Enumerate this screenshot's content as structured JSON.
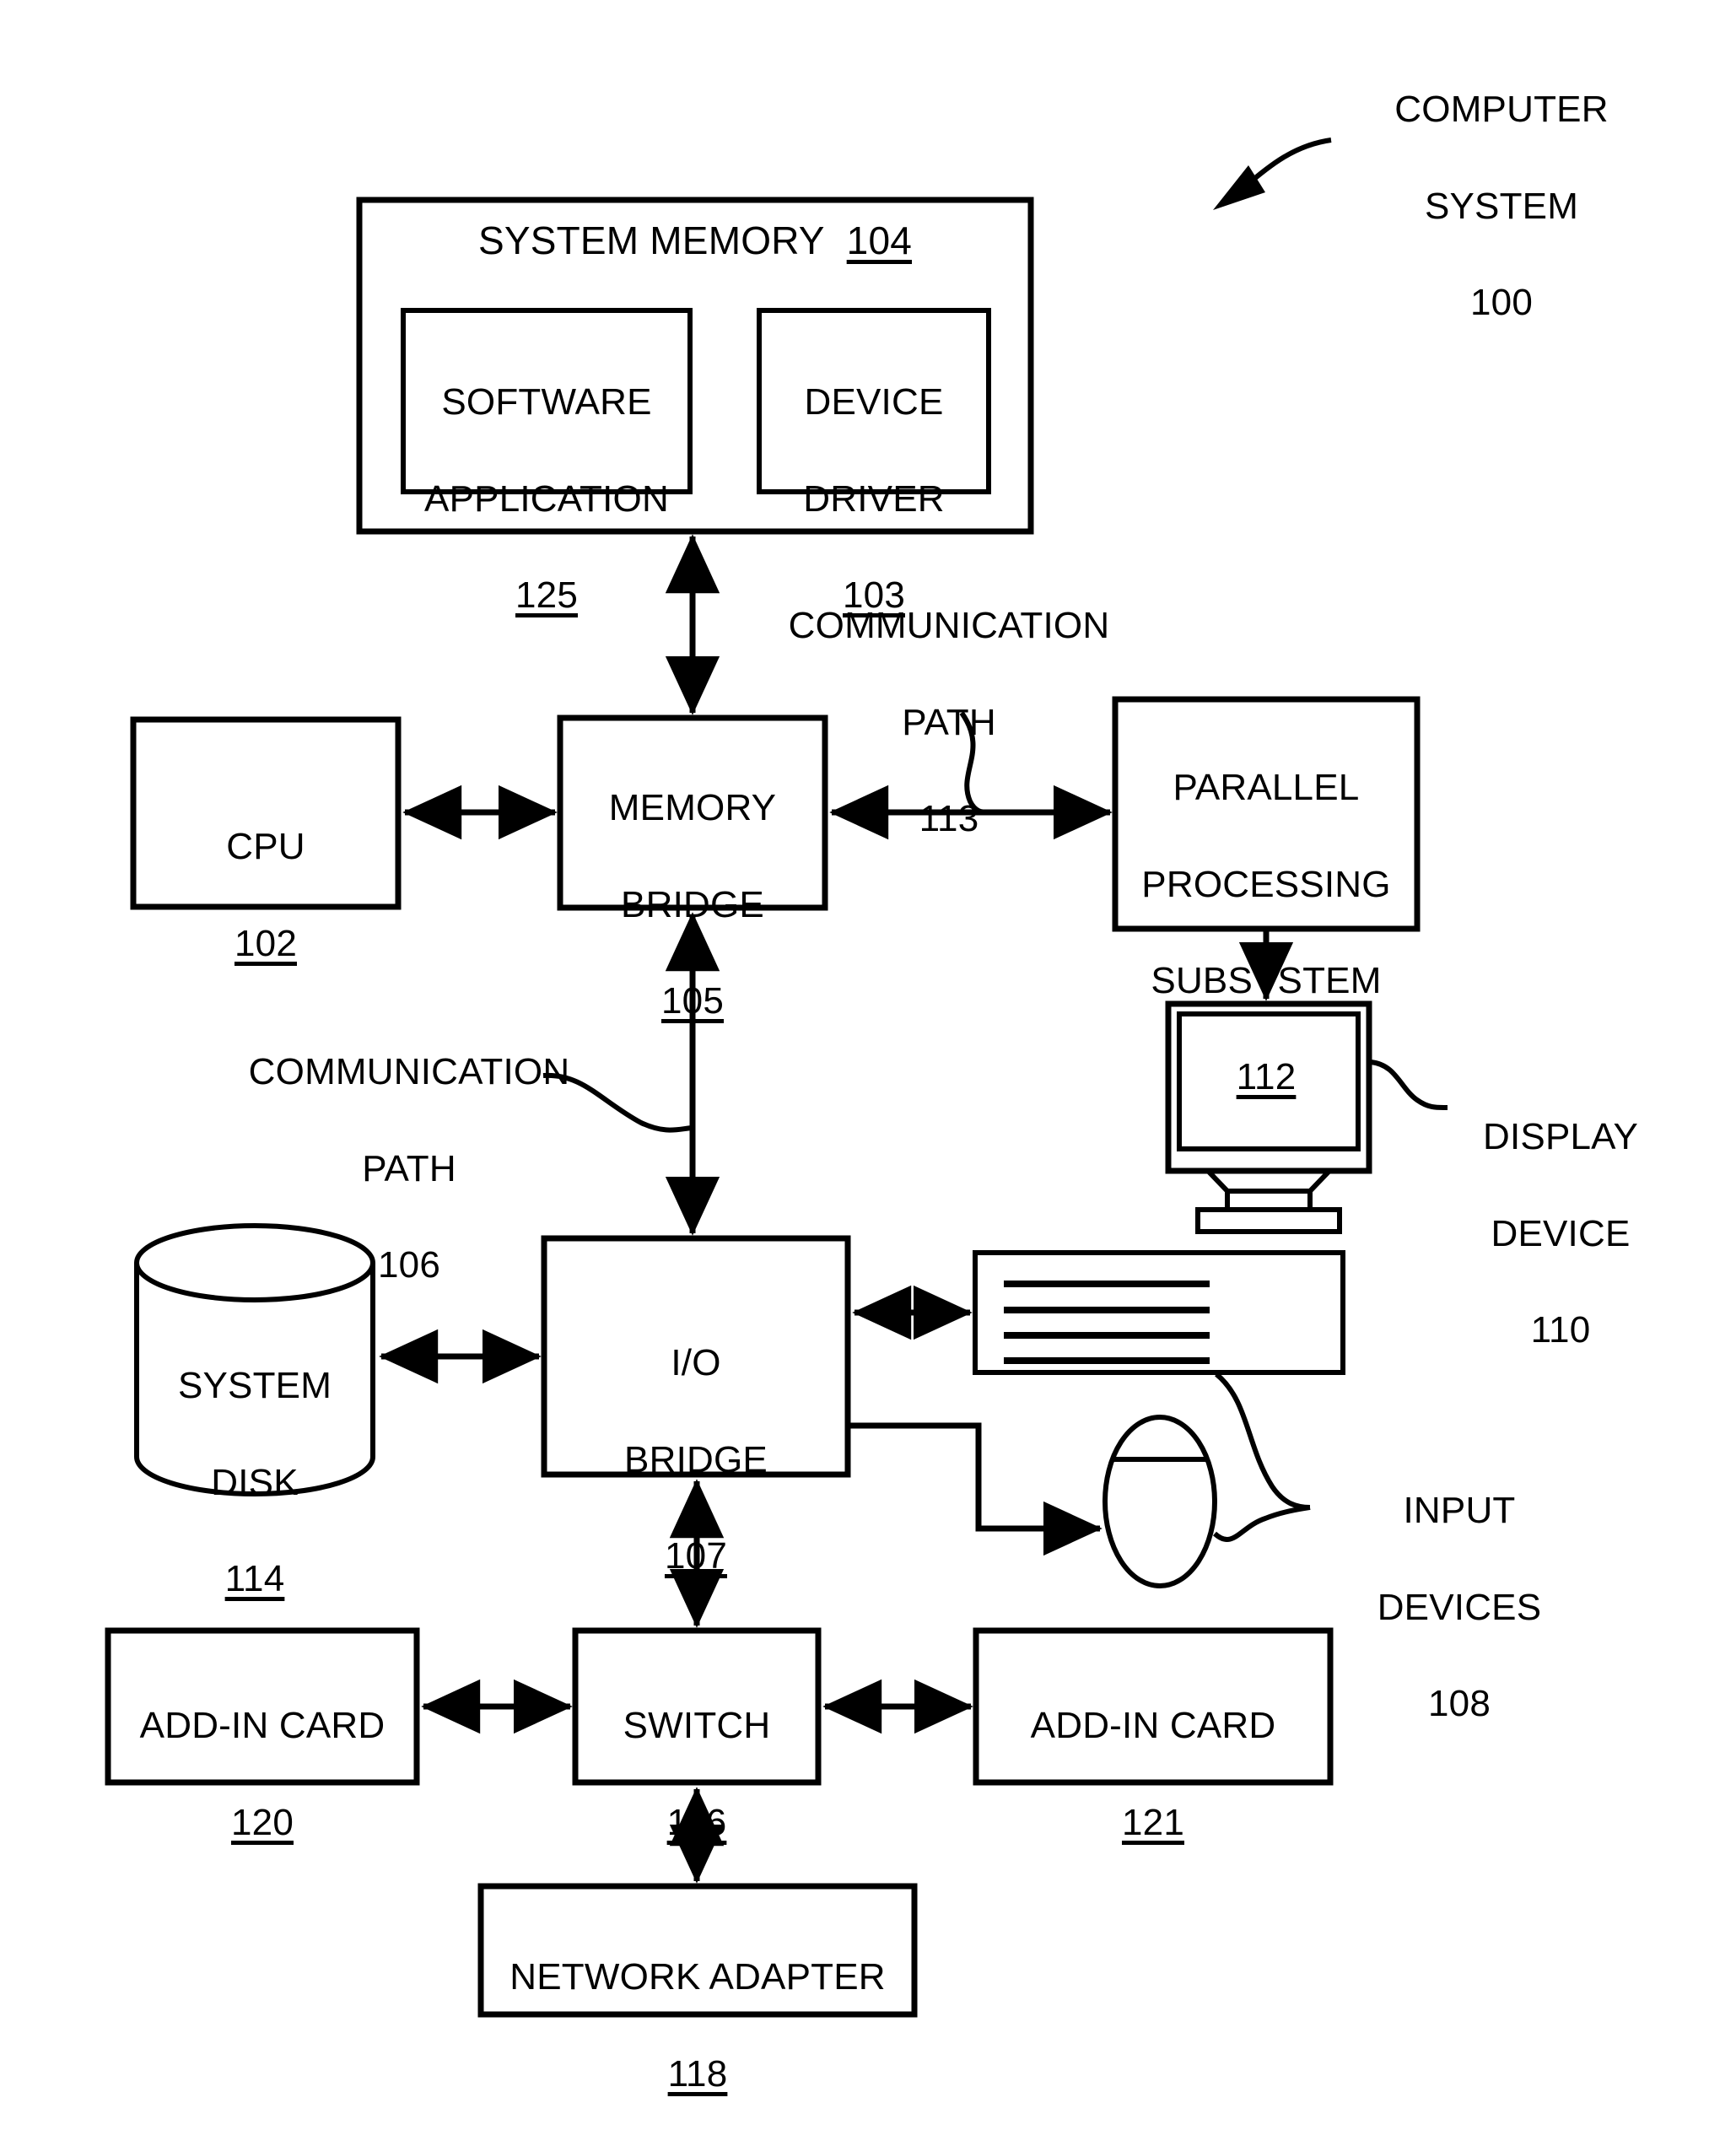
{
  "figure": {
    "title_callout": {
      "lines": [
        "COMPUTER",
        "SYSTEM"
      ],
      "ref": "100"
    }
  },
  "blocks": {
    "system_memory": {
      "label": "SYSTEM MEMORY",
      "ref": "104"
    },
    "software_application": {
      "line1": "SOFTWARE",
      "line2": "APPLICATION",
      "ref": "125"
    },
    "device_driver": {
      "line1": "DEVICE",
      "line2": "DRIVER",
      "ref": "103"
    },
    "cpu": {
      "label": "CPU",
      "ref": "102"
    },
    "memory_bridge": {
      "line1": "MEMORY",
      "line2": "BRIDGE",
      "ref": "105"
    },
    "parallel_processing_subsystem": {
      "line1": "PARALLEL",
      "line2": "PROCESSING",
      "line3": "SUBSYSTEM",
      "ref": "112"
    },
    "system_disk": {
      "line1": "SYSTEM",
      "line2": "DISK",
      "ref": "114"
    },
    "io_bridge": {
      "line1": "I/O",
      "line2": "BRIDGE",
      "ref": "107"
    },
    "switch": {
      "label": "SWITCH",
      "ref": "116"
    },
    "add_in_card_left": {
      "label": "ADD-IN CARD",
      "ref": "120"
    },
    "add_in_card_right": {
      "label": "ADD-IN CARD",
      "ref": "121"
    },
    "network_adapter": {
      "label": "NETWORK ADAPTER",
      "ref": "118"
    }
  },
  "callouts": {
    "communication_path_113": {
      "line1": "COMMUNICATION",
      "line2": "PATH",
      "ref": "113"
    },
    "communication_path_106": {
      "line1": "COMMUNICATION",
      "line2": "PATH",
      "ref": "106"
    },
    "display_device": {
      "line1": "DISPLAY",
      "line2": "DEVICE",
      "ref": "110"
    },
    "input_devices": {
      "line1": "INPUT",
      "line2": "DEVICES",
      "ref": "108"
    }
  },
  "style": {
    "stroke": "#000000",
    "background": "#ffffff"
  }
}
